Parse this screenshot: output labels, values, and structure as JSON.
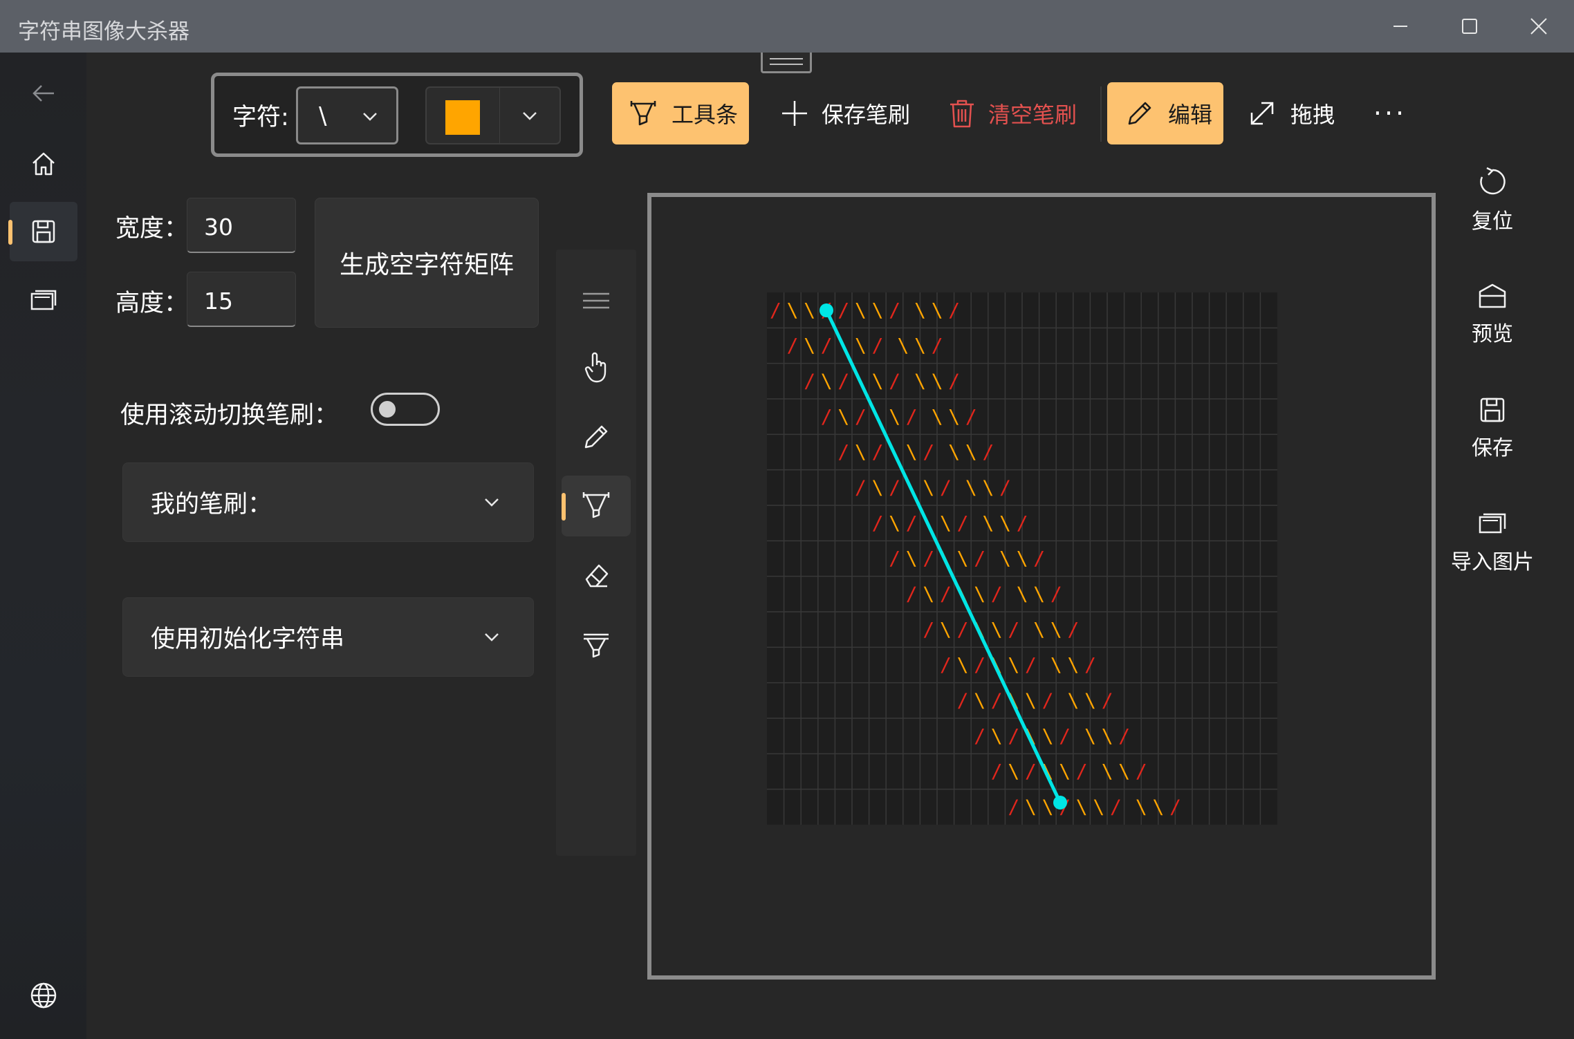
{
  "app": {
    "title": "字符串图像大杀器"
  },
  "toolbar": {
    "char_label": "字符:",
    "char_value": "\\",
    "color_swatch": "#ffa500",
    "toolbar_btn": "工具条",
    "save_brush": "保存笔刷",
    "clear_brush": "清空笔刷",
    "edit": "编辑",
    "drag": "拖拽",
    "more": "···"
  },
  "panel": {
    "width_label": "宽度：",
    "width_value": "30",
    "height_label": "高度：",
    "height_value": "15",
    "generate_btn": "生成空字符矩阵",
    "scroll_switch_label": "使用滚动切换笔刷：",
    "scroll_switch_on": false,
    "my_brushes": "我的笔刷：",
    "init_string": "使用初始化字符串"
  },
  "tools": [
    "menu-icon",
    "hand-icon",
    "pencil-icon",
    "brush-icon",
    "eraser-icon",
    "fill-icon"
  ],
  "active_tool": "brush-icon",
  "side_commands": {
    "reset": "复位",
    "preview": "预览",
    "save": "保存",
    "import_image": "导入图片"
  },
  "colors": {
    "accent": "#fdc270",
    "clear_red": "#e3514f",
    "char_red": "#e0261c",
    "char_orange": "#ffa500",
    "line_cyan": "#00e5e5"
  },
  "grid": {
    "columns": 30,
    "rows": 15,
    "row_strings": [
      "/ \\ \\ / / \\ \\ /  \\ \\ /",
      "/ \\ / \\ \\ /  \\ \\ /",
      "/ \\ / \\ \\ /  \\ \\ /",
      "/ \\ / \\ \\ /  \\ \\ /",
      "/ \\ / \\ \\ /  \\ \\ /",
      "/ \\ / \\ \\ /  \\ \\ /",
      "/ \\ / \\ \\ /  \\ \\ /",
      "/ \\ / \\ \\ /  \\ \\ /",
      "/ \\ / \\ \\ /  \\ \\ /",
      "/ \\ / \\ \\ /  \\ \\ /",
      "/ \\ / \\ \\ /  \\ \\ /",
      "/ \\ / \\ \\ /  \\ \\ /",
      "/ \\ / \\ \\ /  \\ \\ /",
      "/ \\ / \\ \\ /  \\ \\ /",
      "/ \\ \\ / \\ \\ /  \\ \\ /"
    ]
  }
}
